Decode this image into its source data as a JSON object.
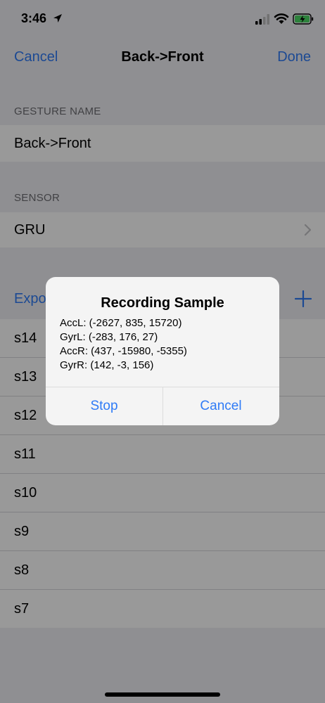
{
  "status_bar": {
    "time": "3:46",
    "icons": [
      "location-arrow-icon",
      "cellular-signal-icon",
      "wifi-icon",
      "battery-charging-icon"
    ]
  },
  "nav": {
    "cancel_label": "Cancel",
    "title": "Back->Front",
    "done_label": "Done"
  },
  "gesture_name": {
    "header": "GESTURE NAME",
    "value": "Back->Front"
  },
  "sensor": {
    "header": "SENSOR",
    "value": "GRU"
  },
  "samples": {
    "export_label": "Expo",
    "add_icon": "plus-icon",
    "items": [
      "s14",
      "s13",
      "s12",
      "s11",
      "s10",
      "s9",
      "s8",
      "s7"
    ]
  },
  "alert": {
    "title": "Recording Sample",
    "lines": [
      "AccL: (-2627, 835, 15720)",
      "GyrL: (-283, 176, 27)",
      "AccR: (437, -15980, -5355)",
      "GyrR: (142, -3, 156)"
    ],
    "stop_label": "Stop",
    "cancel_label": "Cancel"
  },
  "colors": {
    "accent": "#2f7bf6",
    "background": "#efeff4",
    "dim_overlay": "rgba(0,0,0,0.4)",
    "battery_charge": "#4cd964"
  }
}
